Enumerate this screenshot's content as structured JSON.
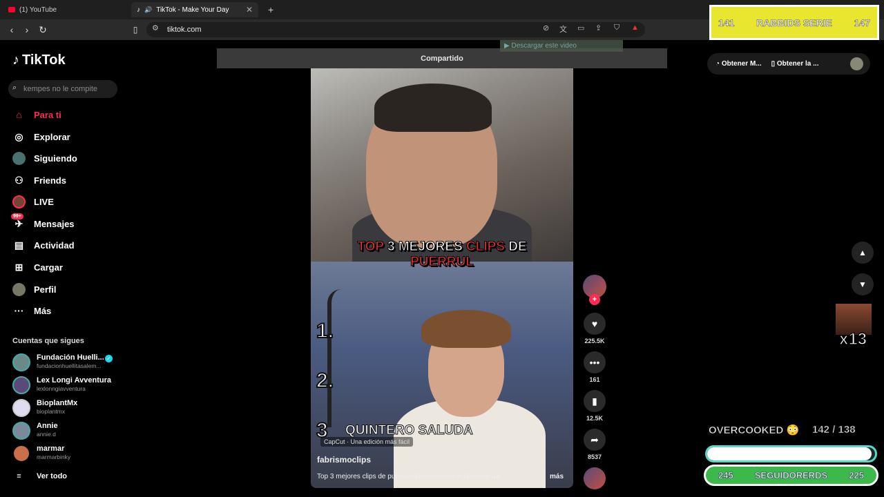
{
  "browser": {
    "tabs": [
      {
        "label": "(1) YouTube"
      },
      {
        "label": "TikTok - Make Your Day"
      }
    ],
    "url": "tiktok.com"
  },
  "tiktok": {
    "logo": "TikTok",
    "search_placeholder": "kempes no le compite",
    "nav": [
      {
        "label": "Para ti",
        "icon": "home-icon"
      },
      {
        "label": "Explorar",
        "icon": "compass-icon"
      },
      {
        "label": "Siguiendo",
        "icon": "following-icon"
      },
      {
        "label": "Friends",
        "icon": "friends-icon"
      },
      {
        "label": "LIVE",
        "icon": "live-icon"
      },
      {
        "label": "Mensajes",
        "icon": "message-icon",
        "badge": "99+"
      },
      {
        "label": "Actividad",
        "icon": "activity-icon"
      },
      {
        "label": "Cargar",
        "icon": "upload-icon"
      },
      {
        "label": "Perfil",
        "icon": "profile-icon"
      },
      {
        "label": "Más",
        "icon": "more-icon"
      }
    ],
    "following_header": "Cuentas que sigues",
    "accounts": [
      {
        "name": "Fundación Huelli...",
        "handle": "fundacionhuellitasalem..."
      },
      {
        "name": "Lex Longi Avventura",
        "handle": "lexlonngiavventura"
      },
      {
        "name": "BioplantMx",
        "handle": "bioplantmx"
      },
      {
        "name": "Annie",
        "handle": "annie.d"
      },
      {
        "name": "marmar",
        "handle": "marmarbinky"
      }
    ],
    "see_all": "Ver todo",
    "shared_label": "Compartido",
    "download_label": "▶ Descargar este video",
    "video": {
      "caption_top_1": "TOP",
      "caption_top_2": "3 MEJORES",
      "caption_top_3": "CLIPS",
      "caption_top_4": "DE",
      "caption_top_5": "PUERRUL",
      "rank_1": "1.",
      "rank_2": "2.",
      "rank_3": "3",
      "clip_caption": "QUINTERO SALUDA",
      "capcut": "CapCut · Una edición más fácil",
      "author": "fabrismoclips",
      "description": "Top 3 mejores clips de puerrul#davooxeneize #davoxeneize ...",
      "more": "más"
    },
    "actions": {
      "likes": "225.5K",
      "comments": "161",
      "saves": "12.5K",
      "shares": "8537"
    },
    "get_app": [
      "Obtener M...",
      "Obtener la ..."
    ]
  },
  "overlay": {
    "rabbids_left": "141",
    "rabbids_title": "RABBIDS SERIE",
    "rabbids_right": "147",
    "multiplier": "x13",
    "overcooked_label": "OVERCOOKED 😳",
    "overcooked_score": "142  / 138",
    "followers_left": "245",
    "followers_label": "SEGUIDORERDS",
    "followers_right": "225",
    "progress_fraction": 0.98
  },
  "colors": {
    "accent": "#fe2c55",
    "overlay_yellow": "#e8e62e",
    "overlay_green": "#3db84a",
    "overlay_teal": "#58d8c8"
  }
}
